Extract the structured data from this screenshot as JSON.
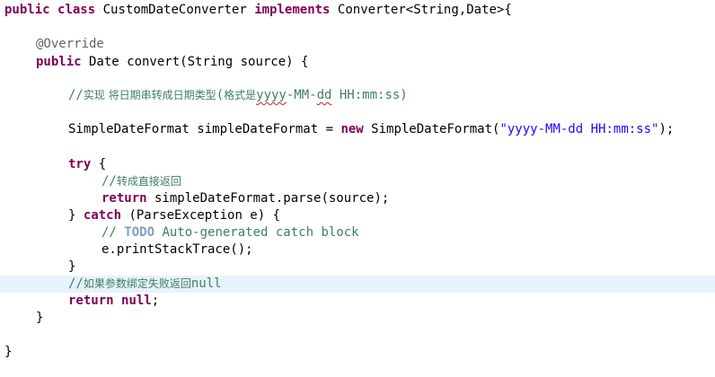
{
  "editor": {
    "lines": [
      {
        "id": "class-decl",
        "tokens": [
          {
            "t": "public",
            "c": "kw"
          },
          {
            "t": " "
          },
          {
            "t": "class",
            "c": "kw"
          },
          {
            "t": " CustomDateConverter "
          },
          {
            "t": "implements",
            "c": "kw"
          },
          {
            "t": " Converter<String,Date>{"
          }
        ]
      },
      {
        "id": "blank-1",
        "tokens": []
      },
      {
        "id": "override",
        "tokens": [
          {
            "t": "@Override",
            "c": "ann"
          }
        ]
      },
      {
        "id": "method-decl",
        "tokens": [
          {
            "t": "public",
            "c": "kw"
          },
          {
            "t": " Date convert(String source) {"
          }
        ]
      },
      {
        "id": "blank-2",
        "tokens": []
      },
      {
        "id": "comment-format",
        "tokens": [
          {
            "t": "//",
            "c": "cm"
          },
          {
            "t": "实现 将日期串转成日期类型",
            "c": "cm cn"
          },
          {
            "t": "(",
            "c": "cm"
          },
          {
            "t": "格式是",
            "c": "cm cn"
          },
          {
            "t": "yyyy",
            "c": "cm squiggle"
          },
          {
            "t": "-MM-",
            "c": "cm"
          },
          {
            "t": "dd",
            "c": "cm squiggle"
          },
          {
            "t": " HH:mm:ss)",
            "c": "cm"
          }
        ]
      },
      {
        "id": "blank-3",
        "tokens": []
      },
      {
        "id": "format-decl",
        "tokens": [
          {
            "t": "SimpleDateFormat simpleDateFormat = "
          },
          {
            "t": "new",
            "c": "kw"
          },
          {
            "t": " SimpleDateFormat("
          },
          {
            "t": "\"yyyy-MM-dd HH:mm:ss\"",
            "c": "str"
          },
          {
            "t": ");"
          }
        ]
      },
      {
        "id": "blank-4",
        "tokens": []
      },
      {
        "id": "try-open",
        "tokens": [
          {
            "t": "try",
            "c": "kw"
          },
          {
            "t": " {"
          }
        ]
      },
      {
        "id": "comment-return",
        "tokens": [
          {
            "t": "//",
            "c": "cm"
          },
          {
            "t": "转成直接返回",
            "c": "cm cn"
          }
        ]
      },
      {
        "id": "return-parse",
        "tokens": [
          {
            "t": "return",
            "c": "kw"
          },
          {
            "t": " simpleDateFormat.parse(source);"
          }
        ]
      },
      {
        "id": "catch-open",
        "tokens": [
          {
            "t": "} "
          },
          {
            "t": "catch",
            "c": "kw"
          },
          {
            "t": " (ParseException e) {"
          }
        ]
      },
      {
        "id": "todo-comment",
        "tokens": [
          {
            "t": "// ",
            "c": "cm"
          },
          {
            "t": "TODO",
            "c": "todo"
          },
          {
            "t": " Auto-generated catch block",
            "c": "cm"
          }
        ]
      },
      {
        "id": "print-stack",
        "tokens": [
          {
            "t": "e.printStackTrace();"
          }
        ]
      },
      {
        "id": "catch-close",
        "tokens": [
          {
            "t": "}"
          }
        ]
      },
      {
        "id": "comment-null",
        "tokens": [
          {
            "t": "//",
            "c": "cm"
          },
          {
            "t": "如果参数绑定失败返回",
            "c": "cm cn"
          },
          {
            "t": "null",
            "c": "cm"
          }
        ]
      },
      {
        "id": "return-null",
        "tokens": [
          {
            "t": "return",
            "c": "kw"
          },
          {
            "t": " "
          },
          {
            "t": "null",
            "c": "kw"
          },
          {
            "t": ";"
          }
        ]
      },
      {
        "id": "method-close",
        "tokens": [
          {
            "t": "}"
          }
        ]
      },
      {
        "id": "blank-5",
        "tokens": []
      },
      {
        "id": "class-close",
        "tokens": [
          {
            "t": "}"
          }
        ]
      }
    ]
  }
}
